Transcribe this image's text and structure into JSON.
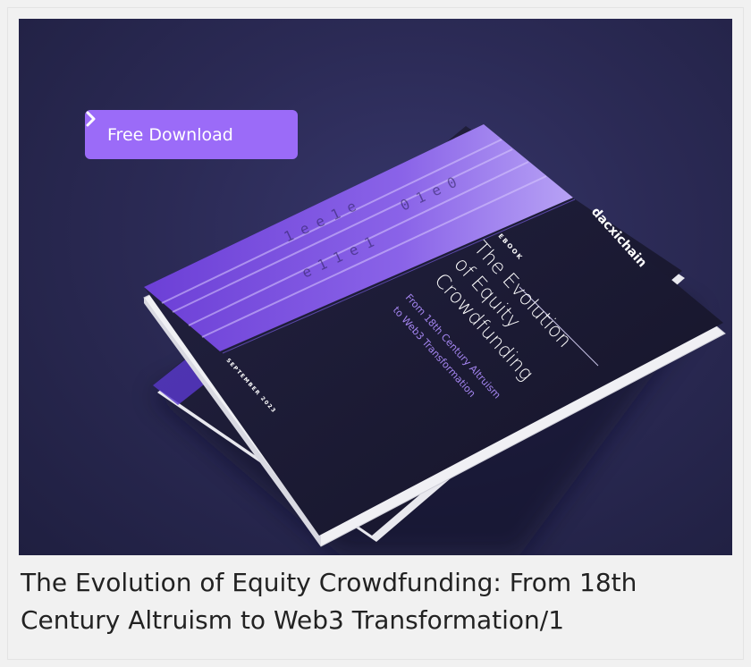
{
  "cta": {
    "label": "Free Download",
    "icon": "chevron-right-icon"
  },
  "book": {
    "brand": "dacxichain",
    "type_label": "EBOOK",
    "title_line1": "The Evolution",
    "title_line2": "of Equity",
    "title_line3": "Crowdfunding",
    "subtitle_line1": "From 18th Century Altruism",
    "subtitle_line2": "to Web3 Transformation",
    "date": "SEPTEMBER 2023"
  },
  "caption": "The Evolution of Equity Crowdfunding: From 18th Century Altruism to Web3 Transformation/1",
  "colors": {
    "accent": "#9b6bf8",
    "background": "#2b2a55",
    "book_cover": "#1c1b35"
  }
}
